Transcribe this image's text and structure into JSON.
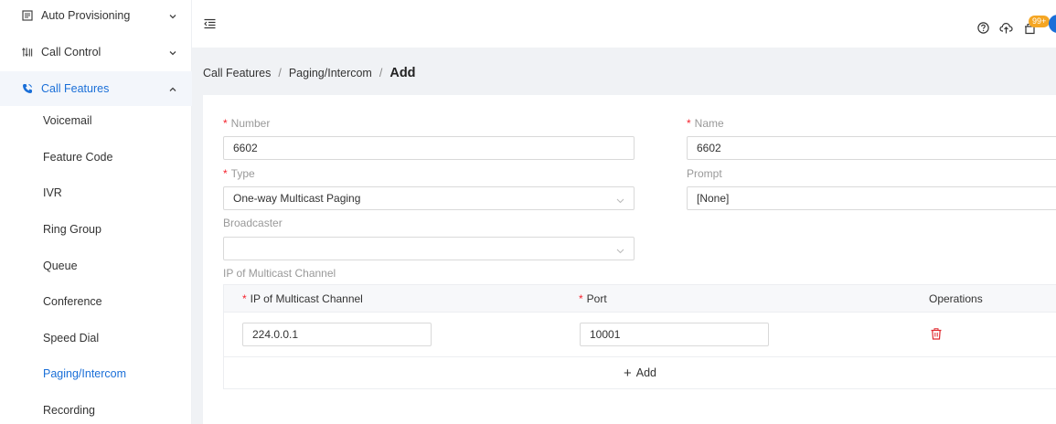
{
  "sidebar": {
    "items": [
      {
        "label": "Auto Provisioning",
        "icon": "auto-provisioning-icon"
      },
      {
        "label": "Call Control",
        "icon": "call-control-icon"
      },
      {
        "label": "Call Features",
        "icon": "call-features-icon"
      }
    ],
    "sub_items": [
      "Voicemail",
      "Feature Code",
      "IVR",
      "Ring Group",
      "Queue",
      "Conference",
      "Speed Dial",
      "Paging/Intercom",
      "Recording"
    ],
    "selected": "Paging/Intercom"
  },
  "topbar": {
    "notification_badge": "99+"
  },
  "breadcrumb": {
    "items": [
      "Call Features",
      "Paging/Intercom"
    ],
    "separator": "/",
    "current": "Add"
  },
  "form": {
    "number": {
      "label": "Number",
      "value": "6602"
    },
    "name": {
      "label": "Name",
      "value": "6602"
    },
    "type": {
      "label": "Type",
      "value": "One-way Multicast Paging"
    },
    "prompt": {
      "label": "Prompt",
      "value": "[None]"
    },
    "broadcaster": {
      "label": "Broadcaster",
      "value": ""
    },
    "multicast_section_label": "IP of Multicast Channel"
  },
  "table": {
    "headers": {
      "ip": "IP of Multicast Channel",
      "port": "Port",
      "operations": "Operations"
    },
    "rows": [
      {
        "ip": "224.0.0.1",
        "port": "10001"
      }
    ],
    "add_label": "Add"
  },
  "colors": {
    "accent": "#1a6fd8",
    "required": "#f5222d",
    "delete": "#e0282e",
    "badge": "#f5a623"
  }
}
